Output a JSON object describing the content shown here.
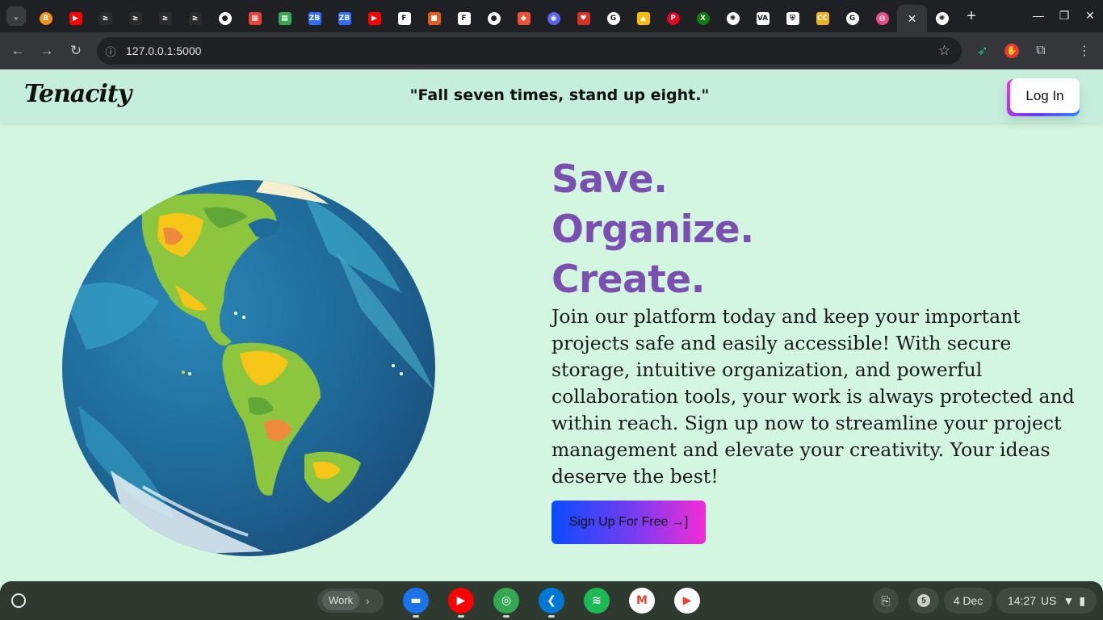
{
  "browser": {
    "tabs": [
      {
        "icon": "bitcoin-icon",
        "color": "#f7931a",
        "glyph": "B"
      },
      {
        "icon": "youtube-icon",
        "color": "#ff0000",
        "glyph": "▶"
      },
      {
        "icon": "swift-bird-icon",
        "color": "#2b2b2b",
        "glyph": "≥"
      },
      {
        "icon": "swift-bird-icon",
        "color": "#2b2b2b",
        "glyph": "≥"
      },
      {
        "icon": "swift-bird-icon",
        "color": "#2b2b2b",
        "glyph": "≥"
      },
      {
        "icon": "swift-bird-icon",
        "color": "#2b2b2b",
        "glyph": "≥"
      },
      {
        "icon": "github-icon",
        "color": "#ffffff",
        "glyph": "●"
      },
      {
        "icon": "grid-app-icon",
        "color": "#e94235",
        "glyph": "▦"
      },
      {
        "icon": "grid-app-icon",
        "color": "#34a853",
        "glyph": "▦"
      },
      {
        "icon": "letters-icon",
        "color": "#2f6cff",
        "glyph": "ZB"
      },
      {
        "icon": "letters-icon",
        "color": "#2f6cff",
        "glyph": "ZB"
      },
      {
        "icon": "youtube-icon",
        "color": "#ff0000",
        "glyph": "▶"
      },
      {
        "icon": "f-logo-icon",
        "color": "#ffffff",
        "glyph": "F"
      },
      {
        "icon": "square-app-icon",
        "color": "#e35a1a",
        "glyph": "■"
      },
      {
        "icon": "f-logo-icon",
        "color": "#ffffff",
        "glyph": "F"
      },
      {
        "icon": "github-icon",
        "color": "#ffffff",
        "glyph": "●"
      },
      {
        "icon": "git-icon",
        "color": "#f05033",
        "glyph": "◆"
      },
      {
        "icon": "discord-icon",
        "color": "#5865f2",
        "glyph": "◉"
      },
      {
        "icon": "figure-icon",
        "color": "#d93025",
        "glyph": "♥"
      },
      {
        "icon": "google-icon",
        "color": "#ffffff",
        "glyph": "G"
      },
      {
        "icon": "google-drive-icon",
        "color": "#fbbc04",
        "glyph": "▲"
      },
      {
        "icon": "pinterest-icon",
        "color": "#e60023",
        "glyph": "P"
      },
      {
        "icon": "xbox-icon",
        "color": "#107c10",
        "glyph": "X"
      },
      {
        "icon": "openai-icon",
        "color": "#ffffff",
        "glyph": "✺"
      },
      {
        "icon": "va-icon",
        "color": "#ffffff",
        "glyph": "VA"
      },
      {
        "icon": "crest-icon",
        "color": "#ffffff",
        "glyph": "⛨"
      },
      {
        "icon": "cc-icon",
        "color": "#f2b01e",
        "glyph": "CC"
      },
      {
        "icon": "google-icon",
        "color": "#ffffff",
        "glyph": "G"
      },
      {
        "icon": "dribbble-icon",
        "color": "#ea4c89",
        "glyph": "◍"
      },
      {
        "icon": "tab-close-icon",
        "color": "#35363a",
        "glyph": "✕"
      },
      {
        "icon": "openai-icon",
        "color": "#ffffff",
        "glyph": "✺"
      }
    ],
    "url": "127.0.0.1:5000"
  },
  "page": {
    "logo": "Tenacity",
    "quote": "\"Fall seven times, stand up eight.\"",
    "login_label": "Log In",
    "hero_lines": [
      "Save.",
      "Organize.",
      "Create."
    ],
    "paragraph": "Join our platform today and keep your important projects safe and easily accessible! With secure storage, intuitive organization, and powerful collaboration tools, your work is always protected and within reach. Sign up now to streamline your project management and elevate your creativity. Your ideas deserve the best!",
    "signup_label": "Sign Up For Free →]",
    "colors": {
      "background": "#d2f6e0",
      "headline": "#7b4fb0"
    }
  },
  "shelf": {
    "desk_label": "Work",
    "apps": [
      {
        "name": "files-app-icon",
        "color": "#1a73e8",
        "glyph": "▬",
        "dot": true
      },
      {
        "name": "youtube-app-icon",
        "color": "#ff0000",
        "glyph": "▶",
        "dot": true
      },
      {
        "name": "chrome-app-icon",
        "color": "#34a853",
        "glyph": "◎",
        "dot": true
      },
      {
        "name": "vscode-app-icon",
        "color": "#0078d4",
        "glyph": "❮",
        "dot": true
      },
      {
        "name": "spotify-app-icon",
        "color": "#1db954",
        "glyph": "≋",
        "dot": false
      },
      {
        "name": "gmail-app-icon",
        "color": "#ffffff",
        "glyph": "M",
        "dot": false
      },
      {
        "name": "play-store-app-icon",
        "color": "#ffffff",
        "glyph": "▶",
        "dot": false
      }
    ],
    "notification_count": "5",
    "date": "4 Dec",
    "time": "14:27",
    "locale": "US"
  }
}
